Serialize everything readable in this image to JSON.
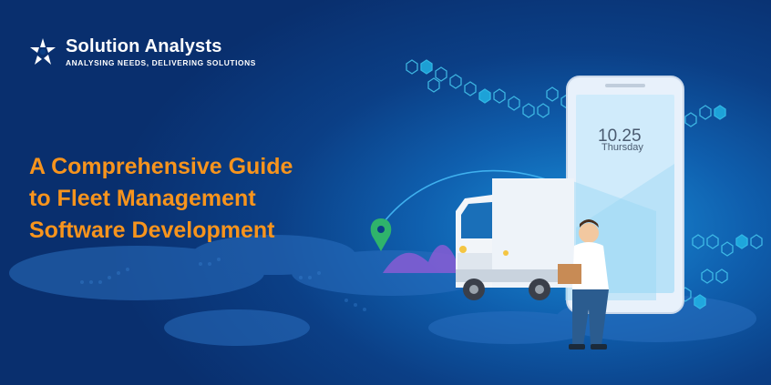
{
  "brand": {
    "name": "Solution Analysts",
    "tagline": "ANALYSING NEEDS, DELIVERING SOLUTIONS"
  },
  "headline": {
    "line1": "A Comprehensive Guide",
    "line2": "to Fleet Management",
    "line3": "Software Development"
  },
  "phone": {
    "time": "10.25",
    "day": "Thursday"
  },
  "colors": {
    "headline": "#f7941d",
    "background": "#0b3f86",
    "accent": "#22b8e8"
  },
  "icons": {
    "logo": "star-logo-icon",
    "pin": "location-pin-icon"
  }
}
